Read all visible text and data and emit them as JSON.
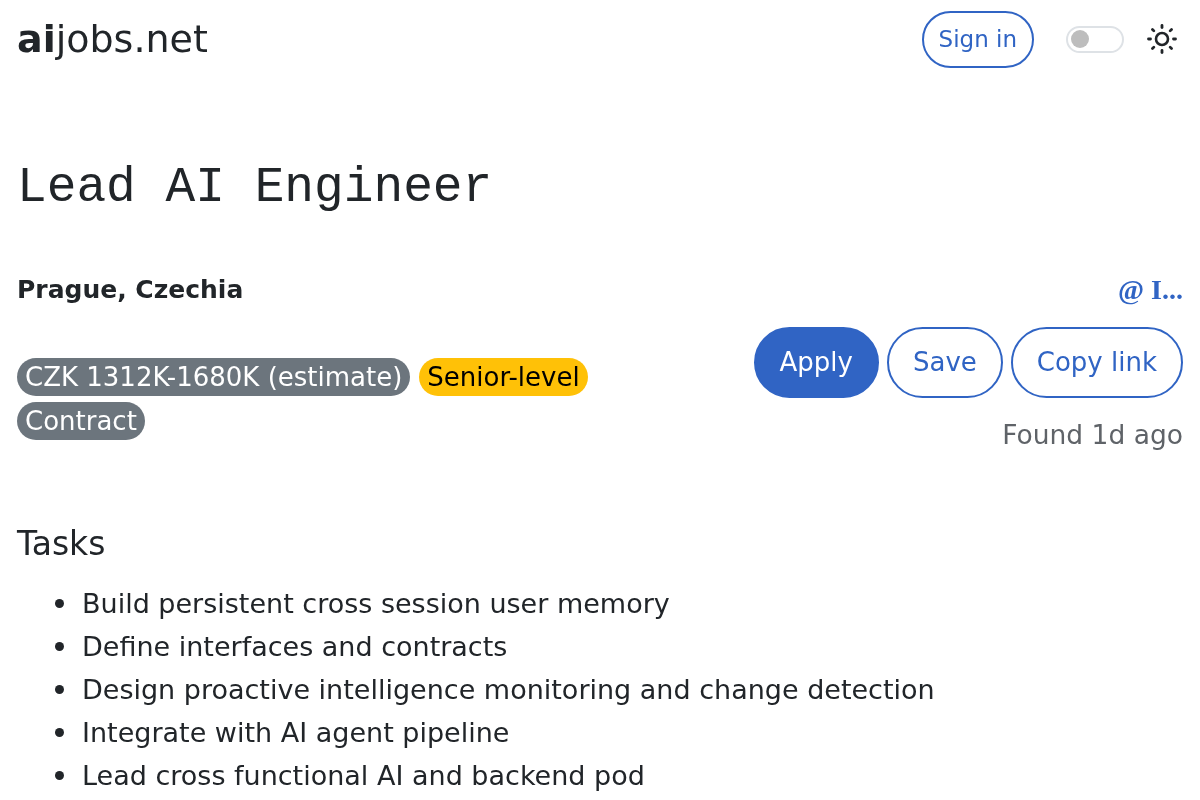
{
  "header": {
    "logo": "**ai**jobs.net",
    "sign_in": "Sign in",
    "theme_toggle": {
      "on": false
    }
  },
  "job": {
    "title": "Lead AI Engineer",
    "location": "Prague, Czechia",
    "company": "@ I...",
    "tags": [
      {
        "label": "CZK 1312K-1680K (estimate)",
        "color": "#6c757d"
      },
      {
        "label": "Senior-level",
        "color": "#ffc107"
      },
      {
        "label": "Contract",
        "color": "#6c757d"
      }
    ],
    "actions": [
      {
        "label": "Apply",
        "kind": "primary"
      },
      {
        "label": "Save",
        "kind": "outline"
      },
      {
        "label": "Copy link",
        "kind": "outline"
      }
    ],
    "found": "Found 1d ago"
  },
  "tasks": {
    "heading": "Tasks",
    "items": [
      "Build persistent cross session user memory",
      "Define interfaces and contracts",
      "Design proactive intelligence monitoring and change detection",
      "Integrate with AI agent pipeline",
      "Lead cross functional AI and backend pod"
    ]
  }
}
